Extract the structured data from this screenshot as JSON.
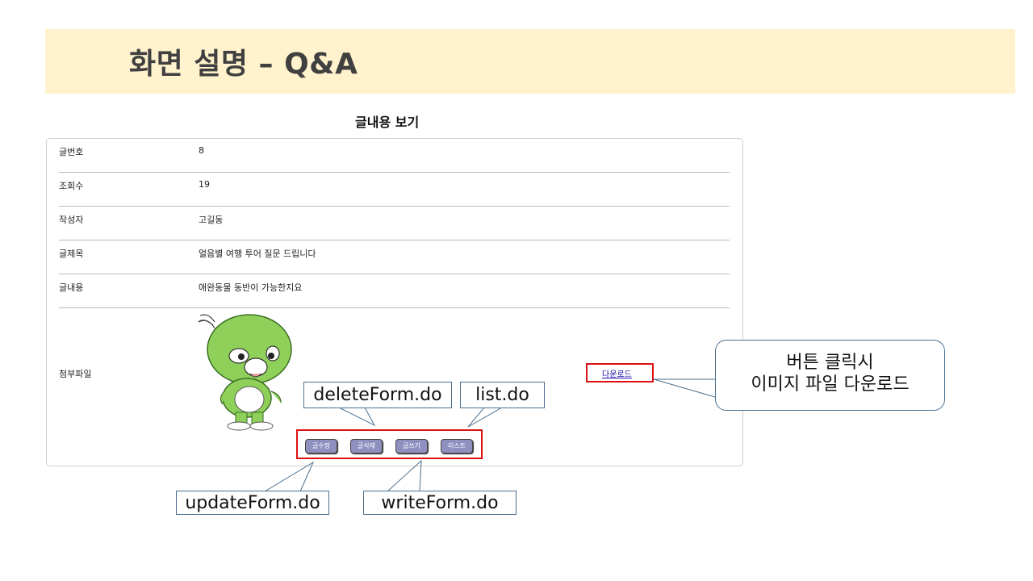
{
  "slide": {
    "title": "화면 설명 – Q&A"
  },
  "view": {
    "title": "글내용 보기",
    "rows": [
      {
        "label": "글번호",
        "value": "8"
      },
      {
        "label": "조회수",
        "value": "19"
      },
      {
        "label": "작성자",
        "value": "고길동"
      },
      {
        "label": "글제목",
        "value": "얼음별 여행 투어 질문 드립니다"
      },
      {
        "label": "글내용",
        "value": "애완동물 동반이 가능한지요"
      }
    ],
    "attachment": {
      "label": "첨부파일",
      "download_label": "다운로드",
      "image_name": "green-cartoon-character"
    },
    "buttons": {
      "edit": "글수정",
      "delete": "글삭제",
      "write": "글쓰기",
      "list": "리스트"
    }
  },
  "callouts": {
    "delete": "deleteForm.do",
    "list": "list.do",
    "update": "updateForm.do",
    "write": "writeForm.do",
    "download_line1": "버튼 클릭시",
    "download_line2": "이미지 파일 다운로드"
  },
  "colors": {
    "title_band": "#fff2cc",
    "highlight": "#dd1111",
    "callout_border": "#4a6f8f",
    "button": "#8f8fc0"
  }
}
